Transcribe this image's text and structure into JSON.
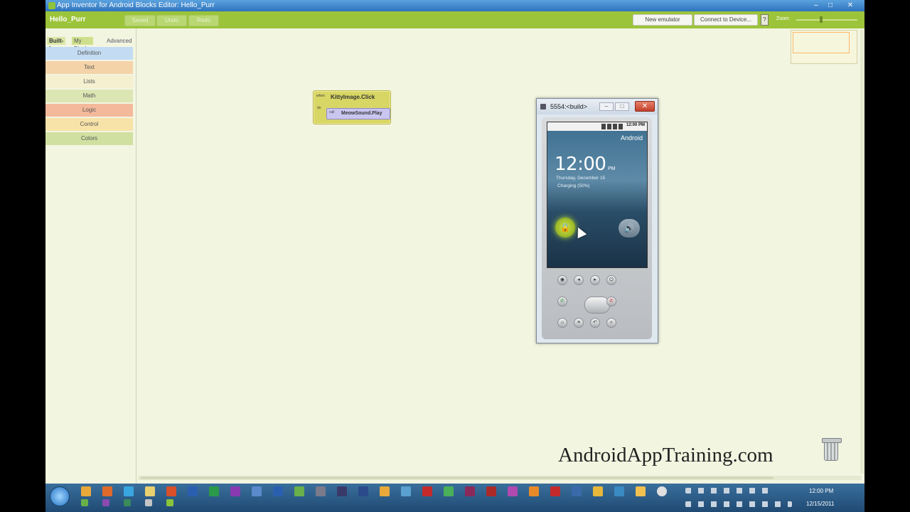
{
  "window": {
    "title": "App Inventor for Android Blocks Editor: Hello_Purr"
  },
  "header": {
    "project": "Hello_Purr",
    "saved_label": "Saved",
    "undo_label": "Undo",
    "redo_label": "Redo",
    "new_emulator_label": "New emulator",
    "connect_label": "Connect to Device...",
    "help_label": "?",
    "zoom_label": "Zoom"
  },
  "palette": {
    "tabs": [
      "Built-In",
      "My Blocks",
      "Advanced"
    ],
    "drawers": [
      {
        "label": "Definition",
        "color": "#c3dcf3"
      },
      {
        "label": "Text",
        "color": "#f5d3a8"
      },
      {
        "label": "Lists",
        "color": "#f5f0cf"
      },
      {
        "label": "Math",
        "color": "#dbe6b3"
      },
      {
        "label": "Logic",
        "color": "#f4b99b"
      },
      {
        "label": "Control",
        "color": "#f7e2a8"
      },
      {
        "label": "Colors",
        "color": "#cfe0a0"
      }
    ]
  },
  "block": {
    "when_label": "when",
    "do_label": "do",
    "event": "KittyImage.Click",
    "call_label": "call",
    "method": "MeowSound.Play"
  },
  "emulator": {
    "title": "5554:<build>",
    "status_time": "12:00 PM",
    "carrier": "Android",
    "time": "12:00",
    "ampm": "PM",
    "date": "Thursday, December 15",
    "charging": "Charging (50%)"
  },
  "watermark": "AndroidAppTraining.com",
  "taskbar": {
    "time": "12:00 PM",
    "date": "12/15/2011"
  }
}
